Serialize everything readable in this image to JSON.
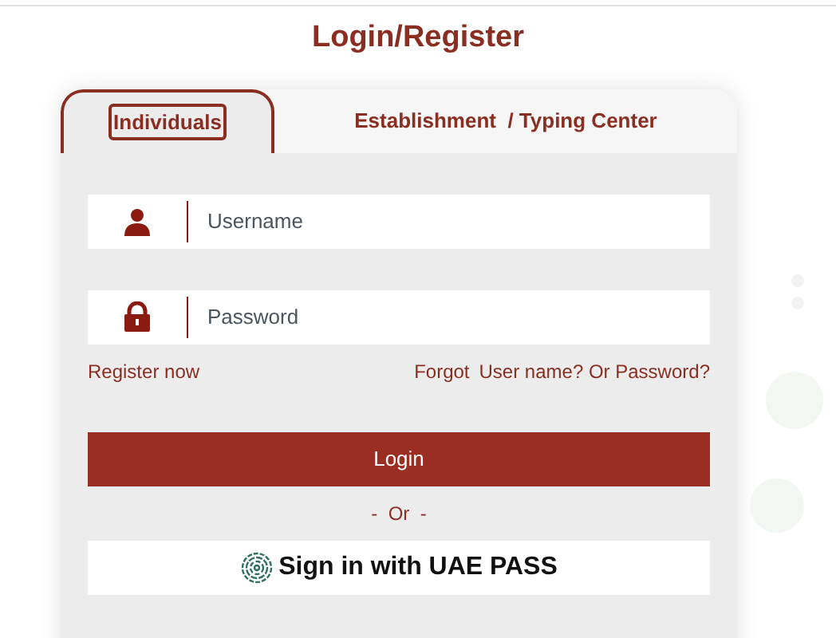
{
  "title": "Login/Register",
  "tabs": [
    {
      "label": "Individuals",
      "selected": true
    },
    {
      "label": "Establishment  / Typing Center",
      "selected": false
    }
  ],
  "username": {
    "placeholder": "Username"
  },
  "password": {
    "placeholder": "Password"
  },
  "register_link": "Register now",
  "forgot": {
    "prefix": "Forgot",
    "link": "User name? Or Password?"
  },
  "login_button": "Login",
  "divider": "-  Or  -",
  "uae_pass_button": "Sign in with UAE PASS"
}
